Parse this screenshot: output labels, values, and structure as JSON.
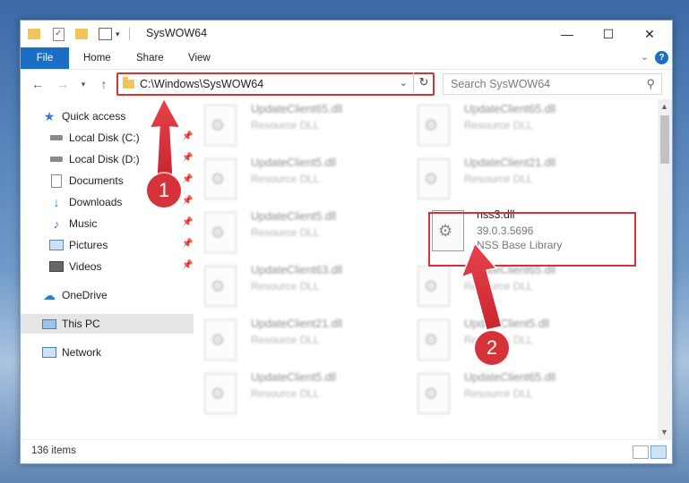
{
  "window": {
    "title": "SysWOW64",
    "controls": {
      "minimize": "—",
      "maximize": "☐",
      "close": "✕"
    }
  },
  "ribbon": {
    "file": "File",
    "tabs": [
      "Home",
      "Share",
      "View"
    ],
    "help": "?"
  },
  "navigation": {
    "address": "C:\\Windows\\SysWOW64",
    "search_placeholder": "Search SysWOW64"
  },
  "sidebar": {
    "quick_access": "Quick access",
    "items": [
      {
        "label": "Local Disk (C:)",
        "icon": "drive-icon"
      },
      {
        "label": "Local Disk (D:)",
        "icon": "drive-icon"
      },
      {
        "label": "Documents",
        "icon": "documents-icon"
      },
      {
        "label": "Downloads",
        "icon": "download-icon"
      },
      {
        "label": "Music",
        "icon": "music-icon"
      },
      {
        "label": "Pictures",
        "icon": "pictures-icon"
      },
      {
        "label": "Videos",
        "icon": "videos-icon"
      }
    ],
    "onedrive": "OneDrive",
    "this_pc": "This PC",
    "network": "Network"
  },
  "files": {
    "left_column": [
      {
        "name": "UpdateClient65.dll",
        "type": "Resource DLL"
      },
      {
        "name": "UpdateClient5.dll",
        "type": "Resource DLL"
      },
      {
        "name": "UpdateClient5.dll",
        "type": "Resource DLL"
      },
      {
        "name": "UpdateClient63.dll",
        "type": "Resource DLL"
      },
      {
        "name": "UpdateClient21.dll",
        "type": "Resource DLL"
      },
      {
        "name": "UpdateClient5.dll",
        "type": "Resource DLL"
      }
    ],
    "right_column": [
      {
        "name": "UpdateClient65.dll",
        "type": "Resource DLL"
      },
      {
        "name": "UpdateClient21.dll",
        "type": "Resource DLL"
      },
      {
        "name": "UpdateClient65.dll",
        "type": "Resource DLL"
      },
      {
        "name": "UpdateClient5.dll",
        "type": "Resource DLL"
      },
      {
        "name": "UpdateClient65.dll",
        "type": "Resource DLL"
      }
    ],
    "highlighted": {
      "name": "nss3.dll",
      "version": "39.0.3.5696",
      "description": "NSS Base Library"
    }
  },
  "status": {
    "item_count": "136 items"
  },
  "callouts": {
    "one": "1",
    "two": "2"
  },
  "colors": {
    "accent": "#1a6fc4",
    "highlight": "#d6323a",
    "folder": "#f2c55c"
  }
}
